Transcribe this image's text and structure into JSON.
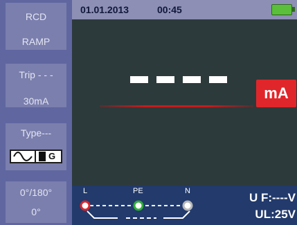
{
  "sidebar": {
    "function": "RCD",
    "mode": "RAMP",
    "trip": "Trip - - -",
    "current": "30mA",
    "type_label": "Type---",
    "type_icons": [
      "ac-sine-icon",
      "g-icon"
    ],
    "type_g": "G",
    "phase_top": "0°/180°",
    "phase_bottom": "0°"
  },
  "status": {
    "date": "01.01.2013",
    "time": "00:45",
    "battery_icon": "battery-icon"
  },
  "display": {
    "reading": "- - - -",
    "unit": "mA",
    "colors": {
      "unit_bg": "#e0262a",
      "indicator": "#c61b1b"
    }
  },
  "terminals": {
    "L": "L",
    "PE": "PE",
    "N": "N",
    "colors": {
      "L": "#d8262c",
      "PE": "#2fae3a",
      "N": "#b8b8b8"
    }
  },
  "voltage": {
    "uf": "U F:----V",
    "ul": "UL:25V"
  }
}
